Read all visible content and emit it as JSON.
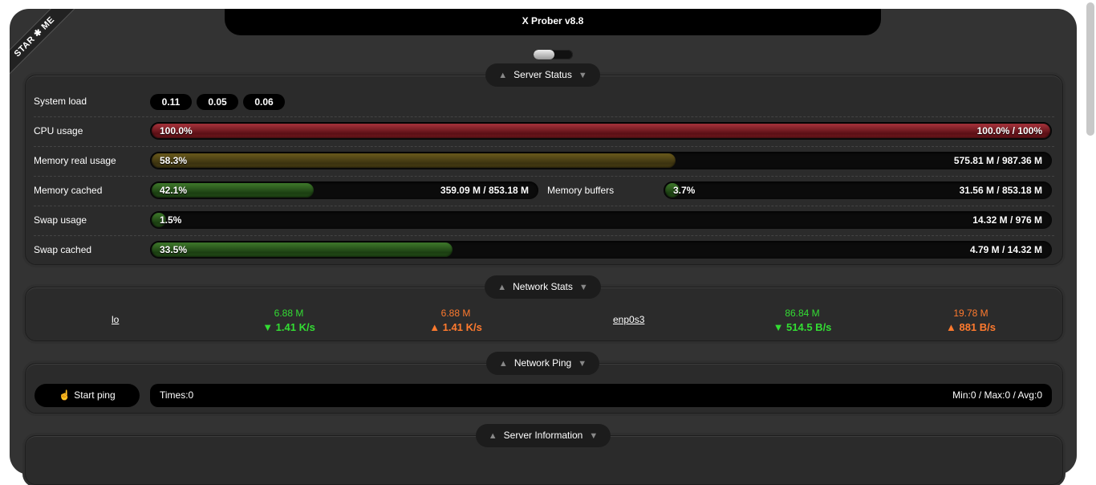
{
  "app": {
    "title": "X Prober v8.8",
    "ribbon": "STAR ✱ ME"
  },
  "server_status": {
    "title": "Server Status",
    "system_load": {
      "label": "System load",
      "values": [
        "0.11",
        "0.05",
        "0.06"
      ]
    },
    "cpu": {
      "label": "CPU usage",
      "percent_text": "100.0%",
      "value_text": "100.0% / 100%",
      "percent": 100
    },
    "mem_real": {
      "label": "Memory real usage",
      "percent_text": "58.3%",
      "value_text": "575.81 M / 987.36 M",
      "percent": 58.3
    },
    "mem_cached": {
      "label": "Memory cached",
      "percent_text": "42.1%",
      "value_text": "359.09 M / 853.18 M",
      "percent": 42.1
    },
    "mem_buffers": {
      "label": "Memory buffers",
      "percent_text": "3.7%",
      "value_text": "31.56 M / 853.18 M",
      "percent": 3.7
    },
    "swap_usage": {
      "label": "Swap usage",
      "percent_text": "1.5%",
      "value_text": "14.32 M / 976 M",
      "percent": 1.5
    },
    "swap_cached": {
      "label": "Swap cached",
      "percent_text": "33.5%",
      "value_text": "4.79 M / 14.32 M",
      "percent": 33.5
    }
  },
  "network_stats": {
    "title": "Network Stats",
    "interfaces": [
      {
        "name": "lo",
        "rx_total": "6.88 M",
        "rx_rate": "▼ 1.41 K/s",
        "tx_total": "6.88 M",
        "tx_rate": "▲ 1.41 K/s"
      },
      {
        "name": "enp0s3",
        "rx_total": "86.84 M",
        "rx_rate": "▼ 514.5 B/s",
        "tx_total": "19.78 M",
        "tx_rate": "▲ 881 B/s"
      }
    ]
  },
  "network_ping": {
    "title": "Network Ping",
    "button": "Start ping",
    "button_icon": "pointer-hand-icon",
    "times": "Times:0",
    "stats": "Min:0 / Max:0 / Avg:0"
  },
  "server_information": {
    "title": "Server Information"
  },
  "colors": {
    "rx": "#33dd33",
    "tx": "#ff7a2e",
    "bar_high": "#8b1e26",
    "bar_mid": "#5a4c18",
    "bar_low": "#2e5a1e"
  }
}
